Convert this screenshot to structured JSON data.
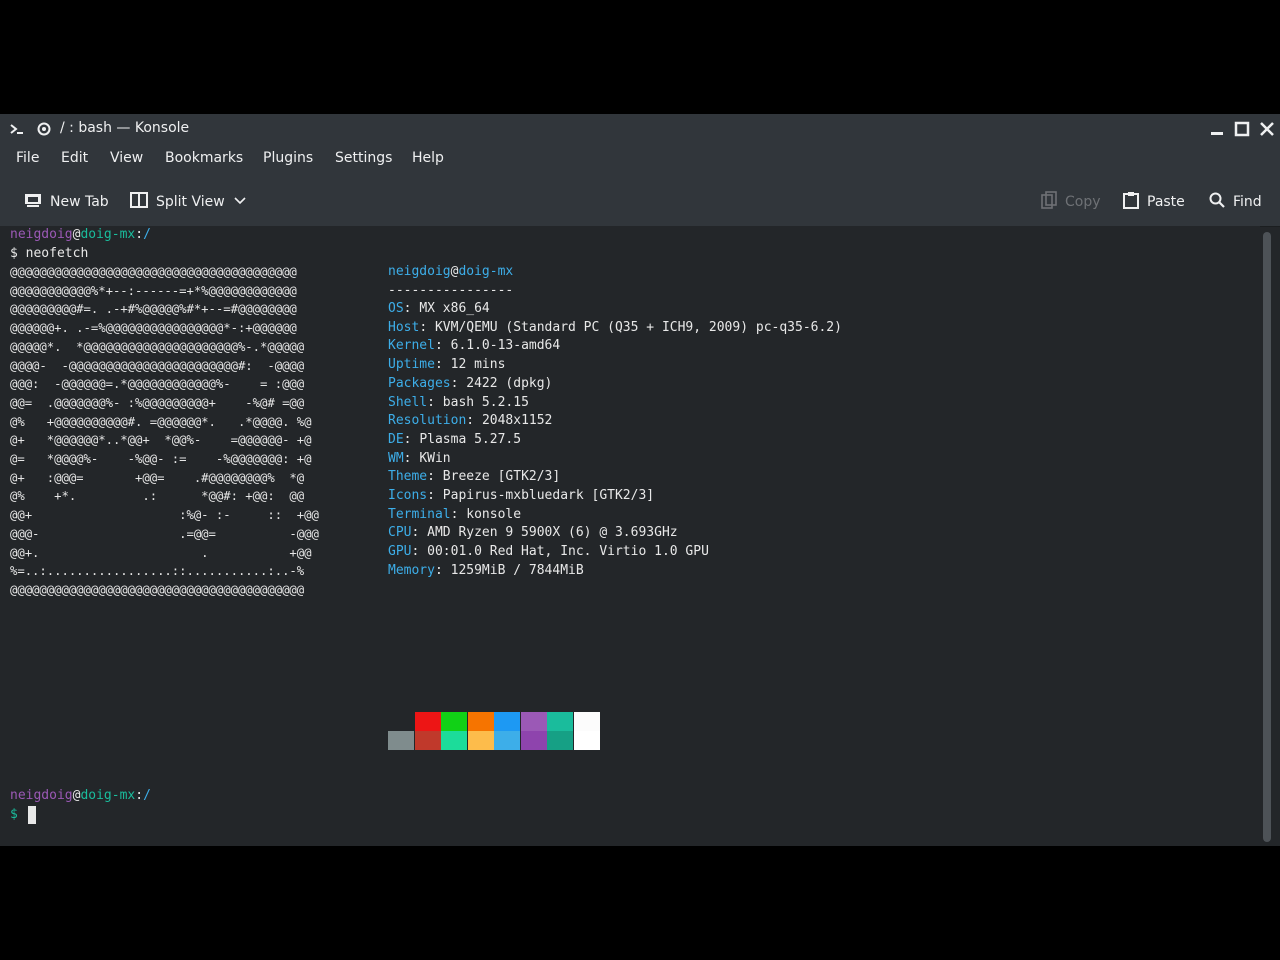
{
  "window": {
    "title": "/ : bash — Konsole"
  },
  "menu": [
    "File",
    "Edit",
    "View",
    "Bookmarks",
    "Plugins",
    "Settings",
    "Help"
  ],
  "toolbar": {
    "new_tab": "New Tab",
    "split_view": "Split View",
    "copy": "Copy",
    "paste": "Paste",
    "find": "Find"
  },
  "terminal": {
    "prompt1": {
      "user": "neigdoig",
      "at": "@",
      "host": "doig-mx",
      "colon": ":",
      "path": "/"
    },
    "command_line": "$ neofetch",
    "ascii_art": [
      "@@@@@@@@@@@@@@@@@@@@@@@@@@@@@@@@@@@@@@@",
      "@@@@@@@@@@@%*+--:------=+*%@@@@@@@@@@@@",
      "@@@@@@@@@#=. .-+#%@@@@@%#*+--=#@@@@@@@@",
      "@@@@@@+. .-=%@@@@@@@@@@@@@@@@*-:+@@@@@@",
      "@@@@@*.  *@@@@@@@@@@@@@@@@@@@@@%-.*@@@@@",
      "@@@@-  -@@@@@@@@@@@@@@@@@@@@@@@#:  -@@@@",
      "@@@:  -@@@@@@=.*@@@@@@@@@@@@%-    = :@@@",
      "@@=  .@@@@@@@%- :%@@@@@@@@@+    -%@# =@@",
      "@%   +@@@@@@@@@@#. =@@@@@@*.   .*@@@@. %@",
      "@+   *@@@@@@*..*@@+  *@@%-    =@@@@@@- +@",
      "@=   *@@@@%-    -%@@- :=    -%@@@@@@@: +@",
      "@+   :@@@=       +@@=    .#@@@@@@@@%  *@",
      "@%    +*.         .:      *@@#: +@@:  @@",
      "@@+                    :%@- :-     ::  +@@",
      "@@@-                   .=@@=          -@@@",
      "@@+.                      .           +@@",
      "%=..:.................::...........:..-%",
      "@@@@@@@@@@@@@@@@@@@@@@@@@@@@@@@@@@@@@@@@"
    ],
    "info_header": {
      "user": "neigdoig",
      "at": "@",
      "host": "doig-mx"
    },
    "separator": "----------------",
    "info": [
      {
        "key": "OS",
        "value": "MX x86_64"
      },
      {
        "key": "Host",
        "value": "KVM/QEMU (Standard PC (Q35 + ICH9, 2009) pc-q35-6.2)"
      },
      {
        "key": "Kernel",
        "value": "6.1.0-13-amd64"
      },
      {
        "key": "Uptime",
        "value": "12 mins"
      },
      {
        "key": "Packages",
        "value": "2422 (dpkg)"
      },
      {
        "key": "Shell",
        "value": "bash 5.2.15"
      },
      {
        "key": "Resolution",
        "value": "2048x1152"
      },
      {
        "key": "DE",
        "value": "Plasma 5.27.5"
      },
      {
        "key": "WM",
        "value": "KWin"
      },
      {
        "key": "Theme",
        "value": "Breeze [GTK2/3]"
      },
      {
        "key": "Icons",
        "value": "Papirus-mxbluedark [GTK2/3]"
      },
      {
        "key": "Terminal",
        "value": "konsole"
      },
      {
        "key": "CPU",
        "value": "AMD Ryzen 9 5900X (6) @ 3.693GHz"
      },
      {
        "key": "GPU",
        "value": "00:01.0 Red Hat, Inc. Virtio 1.0 GPU"
      },
      {
        "key": "Memory",
        "value": "1259MiB / 7844MiB"
      }
    ],
    "palette_top": [
      "#232629",
      "#ed1515",
      "#11d116",
      "#f67400",
      "#1d99f3",
      "#9b59b6",
      "#1abc9c",
      "#fcfcfc"
    ],
    "palette_bottom": [
      "#7f8c8d",
      "#c0392b",
      "#1cdc9a",
      "#fdbc4b",
      "#3daee9",
      "#8e44ad",
      "#16a085",
      "#ffffff"
    ],
    "prompt2": {
      "user": "neigdoig",
      "at": "@",
      "host": "doig-mx",
      "colon": ":",
      "path": "/"
    },
    "prompt2_dollar": "$"
  }
}
